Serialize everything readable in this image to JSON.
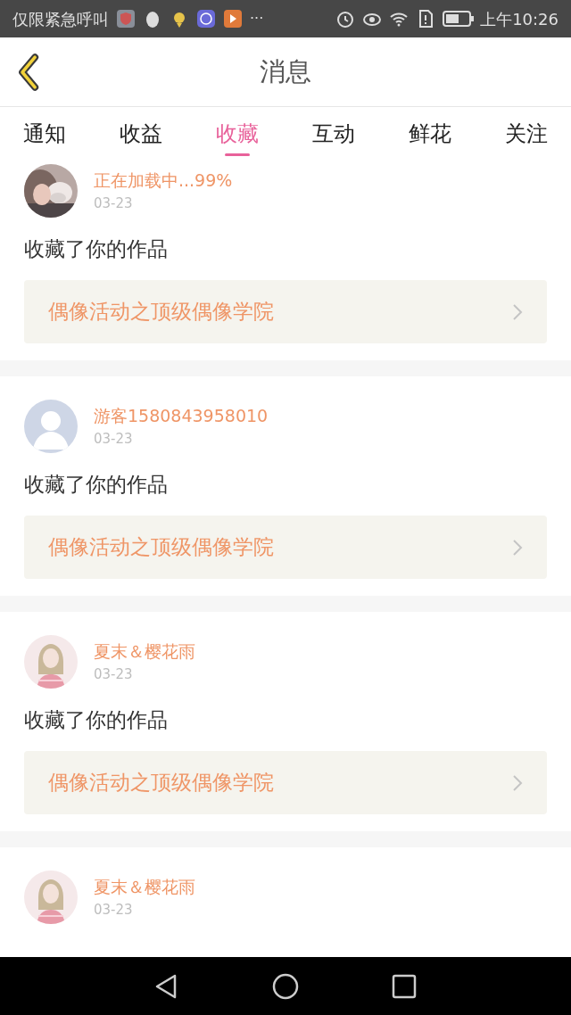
{
  "status_bar": {
    "carrier": "仅限紧急呼叫",
    "more": "···",
    "time": "上午10:26"
  },
  "header": {
    "title": "消息"
  },
  "tabs": [
    {
      "label": "通知",
      "selected": false
    },
    {
      "label": "收益",
      "selected": false
    },
    {
      "label": "收藏",
      "selected": true
    },
    {
      "label": "互动",
      "selected": false
    },
    {
      "label": "鲜花",
      "selected": false
    },
    {
      "label": "关注",
      "selected": false
    }
  ],
  "messages": [
    {
      "name": "正在加载中...99%",
      "date": "03-23",
      "text": "收藏了你的作品",
      "work": "偶像活动之顶级偶像学院"
    },
    {
      "avatar": {
        "kind": "silhouette"
      },
      "name": "游客1580843958010",
      "date": "03-23",
      "text": "收藏了你的作品",
      "work": "偶像活动之顶级偶像学院"
    },
    {
      "avatar": {
        "kind": "figure"
      },
      "name": "夏末＆樱花雨",
      "date": "03-23",
      "text": "收藏了你的作品",
      "work": "偶像活动之顶级偶像学院"
    },
    {
      "avatar": {
        "kind": "figure"
      },
      "name": "夏末＆樱花雨",
      "date": "03-23"
    }
  ]
}
